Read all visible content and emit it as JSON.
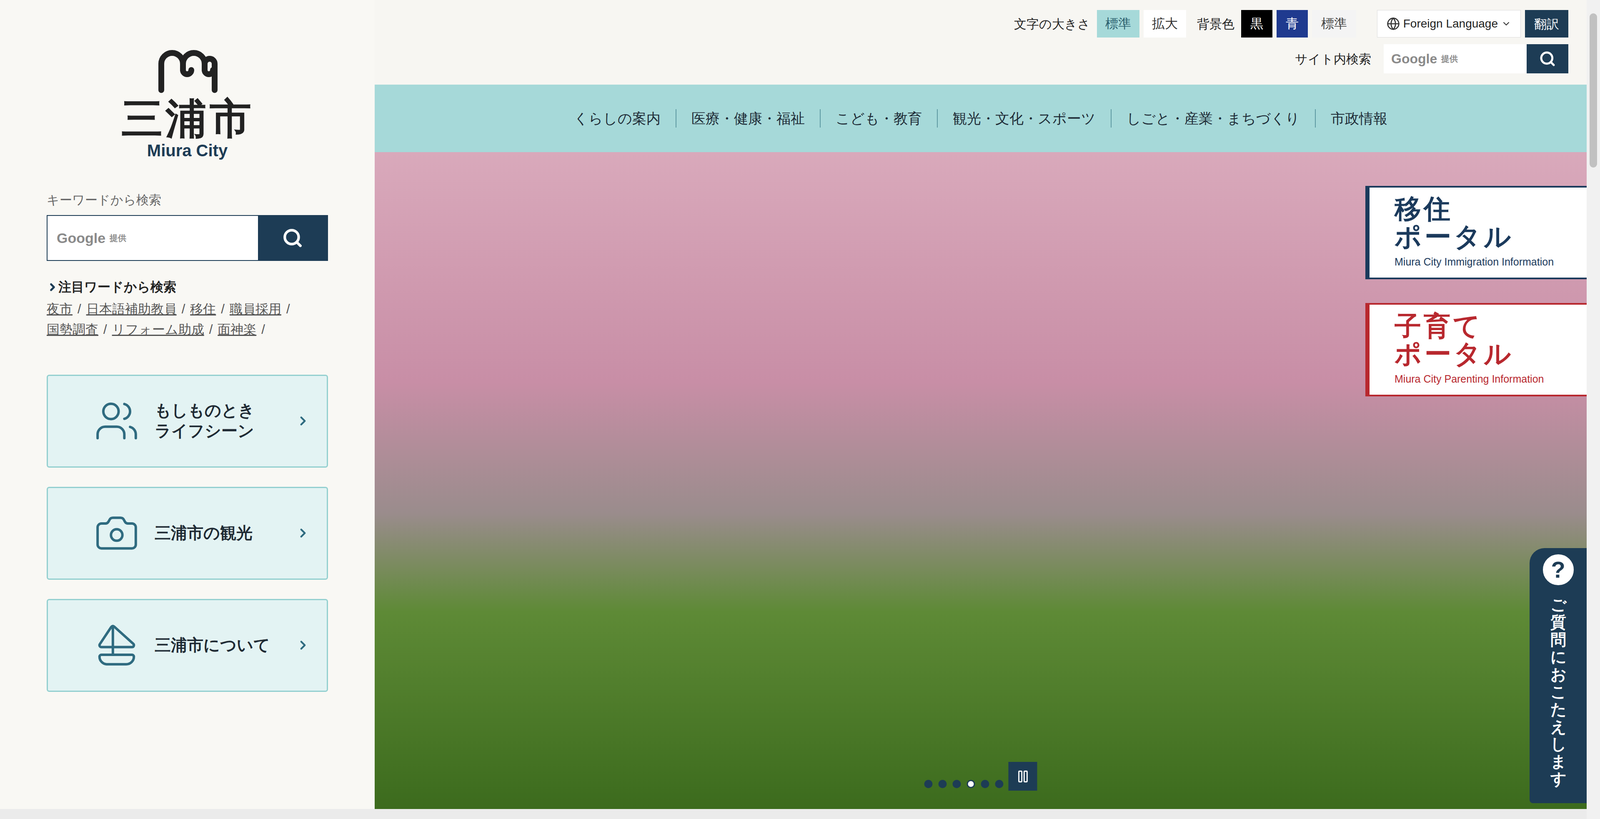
{
  "logo": {
    "name": "三浦市",
    "romaji": "Miura City"
  },
  "header": {
    "font_size": {
      "label": "文字の大きさ",
      "options": [
        {
          "label": "標準",
          "selected": true
        },
        {
          "label": "拡大",
          "selected": false
        }
      ]
    },
    "background": {
      "label": "背景色",
      "options": [
        {
          "label": "黒",
          "color": "#000000"
        },
        {
          "label": "青",
          "color": "#1f3a8f"
        },
        {
          "label": "標準",
          "color": "#f4f4f4"
        }
      ]
    },
    "language": {
      "label": "Foreign Language",
      "button": "翻訳"
    },
    "site_search": {
      "label": "サイト内検索",
      "brand": "Google",
      "suffix": "提供"
    }
  },
  "nav": [
    "くらしの案内",
    "医療・健康・福祉",
    "こども・教育",
    "観光・文化・スポーツ",
    "しごと・産業・まちづくり",
    "市政情報"
  ],
  "sidebar": {
    "search": {
      "label": "キーワードから検索",
      "brand": "Google",
      "suffix": "提供"
    },
    "featured": {
      "title": "注目ワードから検索",
      "separator": "/",
      "words": [
        "夜市",
        "日本語補助教員",
        "移住",
        "職員採用",
        "国勢調査",
        "リフォーム助成",
        "面神楽"
      ]
    },
    "cards": [
      {
        "lines": [
          "もしものとき",
          "ライフシーン"
        ]
      },
      {
        "lines": [
          "三浦市の観光"
        ]
      },
      {
        "lines": [
          "三浦市について"
        ]
      }
    ]
  },
  "banners": [
    {
      "title_lines": [
        "移住",
        "ポータル"
      ],
      "subtitle": "Miura City Immigration Information",
      "color": "#1b3a5c"
    },
    {
      "title_lines": [
        "子育て",
        "ポータル"
      ],
      "subtitle": "Miura City Parenting Information",
      "color": "#b8282e"
    }
  ],
  "slider": {
    "playing": true,
    "slides": [
      {
        "selected": false
      },
      {
        "selected": false
      },
      {
        "selected": false
      },
      {
        "selected": true
      },
      {
        "selected": false
      },
      {
        "selected": false
      }
    ]
  },
  "faq": {
    "icon": "?",
    "label": "ご質問におこたえします"
  }
}
